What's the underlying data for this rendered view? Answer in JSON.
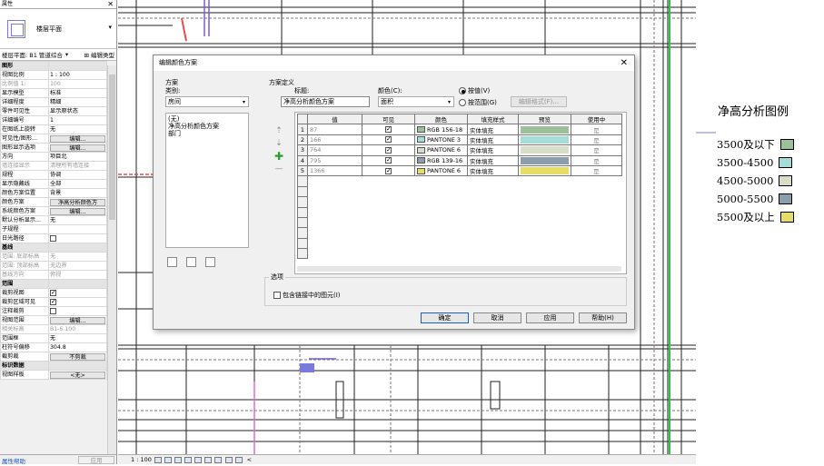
{
  "properties": {
    "title": "属性",
    "type_selector": "楼层平面",
    "selector_row": "楼层平面: B1 管道综合",
    "edit_type": "编辑类型",
    "rows": [
      {
        "k": "图形",
        "v": "",
        "group": true
      },
      {
        "k": "视图比例",
        "v": "1 : 100"
      },
      {
        "k": "比例值 1:",
        "v": "100",
        "dim": true
      },
      {
        "k": "显示模型",
        "v": "标准"
      },
      {
        "k": "详细程度",
        "v": "精细"
      },
      {
        "k": "零件可见性",
        "v": "显示原状态"
      },
      {
        "k": "详细编号",
        "v": "1"
      },
      {
        "k": "在图纸上旋转",
        "v": "无"
      },
      {
        "k": "可见性/图形...",
        "v": "编辑...",
        "btn": true
      },
      {
        "k": "图形显示选项",
        "v": "编辑...",
        "btn": true
      },
      {
        "k": "方向",
        "v": "项目北"
      },
      {
        "k": "墙连接显示",
        "v": "清理所有墙连接",
        "dim": true
      },
      {
        "k": "规程",
        "v": "协调"
      },
      {
        "k": "显示隐藏线",
        "v": "全部"
      },
      {
        "k": "颜色方案位置",
        "v": "背景"
      },
      {
        "k": "颜色方案",
        "v": "净高分析颜色方",
        "btn": true
      },
      {
        "k": "系统颜色方案",
        "v": "编辑...",
        "btn": true
      },
      {
        "k": "默认分析显示...",
        "v": "无"
      },
      {
        "k": "子规程",
        "v": ""
      },
      {
        "k": "日光路径",
        "v": "",
        "cb": "off"
      },
      {
        "k": "基线",
        "v": "",
        "group": true
      },
      {
        "k": "范围: 底部标高",
        "v": "无",
        "dim": true
      },
      {
        "k": "范围: 顶部标高",
        "v": "无边界",
        "dim": true
      },
      {
        "k": "基线方向",
        "v": "俯视",
        "dim": true
      },
      {
        "k": "范围",
        "v": "",
        "group": true
      },
      {
        "k": "裁剪视图",
        "v": "",
        "cb": "on"
      },
      {
        "k": "裁剪区域可见",
        "v": "",
        "cb": "on"
      },
      {
        "k": "注释裁剪",
        "v": "",
        "cb": "off"
      },
      {
        "k": "视图范围",
        "v": "编辑...",
        "btn": true
      },
      {
        "k": "相关标高",
        "v": "B1-6.100",
        "dim": true
      },
      {
        "k": "范围框",
        "v": "无"
      },
      {
        "k": "柱符号偏移",
        "v": "304.8"
      },
      {
        "k": "截剪裁",
        "v": "不剪裁",
        "btn": true
      },
      {
        "k": "标识数据",
        "v": "",
        "group": true
      },
      {
        "k": "视图样板",
        "v": "<无>",
        "btn": true
      }
    ],
    "help_link": "属性帮助",
    "apply_label": "应用"
  },
  "statusbar": {
    "scale": "1 : 100"
  },
  "legend": {
    "title": "净高分析图例",
    "items": [
      {
        "label": "3500及以下",
        "color": "#9cc09a"
      },
      {
        "label": "3500-4500",
        "color": "#a6dcd8"
      },
      {
        "label": "4500-5000",
        "color": "#d8ddc8"
      },
      {
        "label": "5000-5500",
        "color": "#8a9eab"
      },
      {
        "label": "5500及以上",
        "color": "#e6dc6a"
      }
    ]
  },
  "dialog": {
    "title": "编辑颜色方案",
    "scheme_label": "方案",
    "category_label": "类别:",
    "category_value": "房间",
    "scheme_list": [
      "(无)",
      "净高分析颜色方案",
      "部门"
    ],
    "scheme_def_label": "方案定义",
    "title_label": "标题:",
    "title_value": "净高分析颜色方案",
    "color_label": "颜色(C):",
    "color_value": "面积",
    "radio_value": "按值(V)",
    "radio_range": "按范围(G)",
    "edit_format": "编辑格式(F)...",
    "columns": [
      "",
      "值",
      "可见",
      "颜色",
      "填充样式",
      "预览",
      "使用中"
    ],
    "rows": [
      {
        "n": "1",
        "value": "87",
        "visible": true,
        "color": "RGB 156-18",
        "swatch": "#9cc09a",
        "fill": "实体填充",
        "preview": "#9cc09a",
        "used": "是"
      },
      {
        "n": "2",
        "value": "166",
        "visible": true,
        "color": "PANTONE 3",
        "swatch": "#a6dcd8",
        "fill": "实体填充",
        "preview": "#a6dcd8",
        "used": "是"
      },
      {
        "n": "3",
        "value": "764",
        "visible": true,
        "color": "PANTONE 6",
        "swatch": "#d8ddc8",
        "fill": "实体填充",
        "preview": "#d8ddc8",
        "used": "是"
      },
      {
        "n": "4",
        "value": "795",
        "visible": true,
        "color": "RGB 139-16",
        "swatch": "#8a9eab",
        "fill": "实体填充",
        "preview": "#8a9eab",
        "used": "是"
      },
      {
        "n": "5",
        "value": "1366",
        "visible": true,
        "color": "PANTONE 6",
        "swatch": "#e6dc6a",
        "fill": "实体填充",
        "preview": "#e6dc6a",
        "used": "是"
      }
    ],
    "options_label": "选项",
    "include_links": "包含链接中的图元(I)",
    "ok": "确定",
    "cancel": "取消",
    "apply": "应用",
    "help": "帮助(H)"
  }
}
